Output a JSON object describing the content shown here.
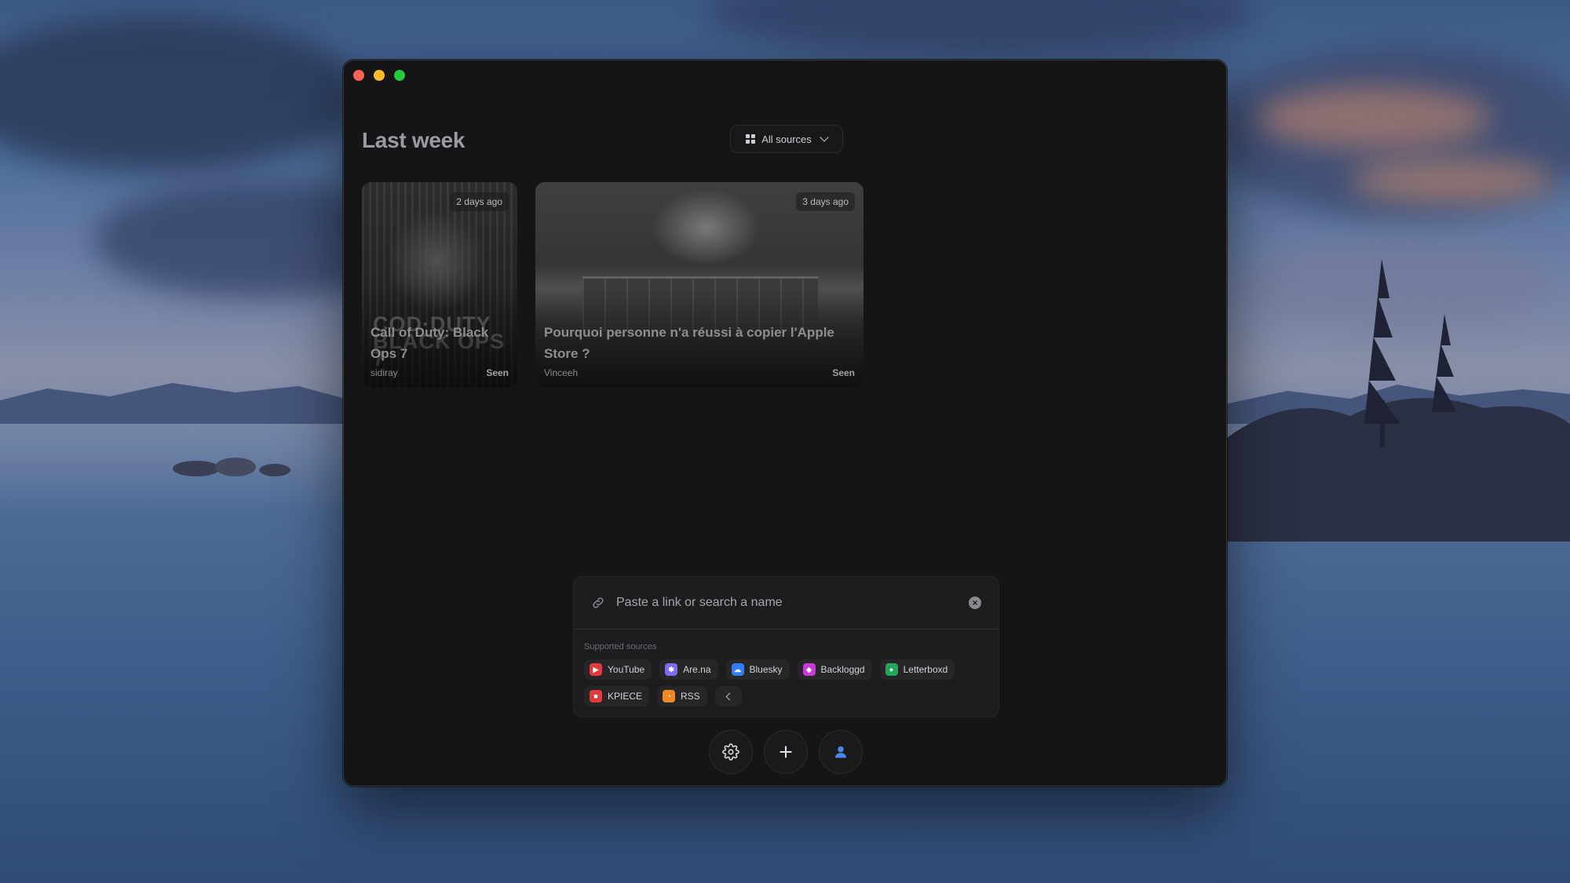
{
  "window": {
    "title": "Last week",
    "filter": {
      "label": "All sources",
      "icon": "grid-icon"
    }
  },
  "cards": [
    {
      "time": "2 days ago",
      "title": "Call of Duty: Black Ops 7",
      "source": "sidiray",
      "status": "Seen"
    },
    {
      "time": "3 days ago",
      "title": "Pourquoi personne n'a réussi à copier l'Apple Store ?",
      "source": "Vinceeh",
      "status": "Seen"
    }
  ],
  "search": {
    "placeholder": "Paste a link or search a name",
    "value": "",
    "sources_label": "Supported sources",
    "sources": [
      {
        "name": "YouTube",
        "color": "#e23b3b",
        "icon": "youtube-icon"
      },
      {
        "name": "Are.na",
        "color": "#7b6cf0",
        "icon": "arena-icon"
      },
      {
        "name": "Bluesky",
        "color": "#2f7ff0",
        "icon": "bluesky-icon"
      },
      {
        "name": "Backloggd",
        "color": "#c93ad6",
        "icon": "backloggd-icon"
      },
      {
        "name": "Letterboxd",
        "color": "#23a85a",
        "icon": "letterboxd-icon"
      },
      {
        "name": "KPIECE",
        "color": "#e03a3a",
        "icon": "kpiece-icon"
      },
      {
        "name": "RSS",
        "color": "#f08a24",
        "icon": "rss-icon"
      }
    ]
  },
  "toolbar": {
    "buttons": [
      {
        "name": "settings",
        "icon": "gear-icon"
      },
      {
        "name": "add",
        "icon": "plus-icon"
      },
      {
        "name": "profile",
        "icon": "user-icon",
        "color": "#4a86f0"
      }
    ]
  }
}
